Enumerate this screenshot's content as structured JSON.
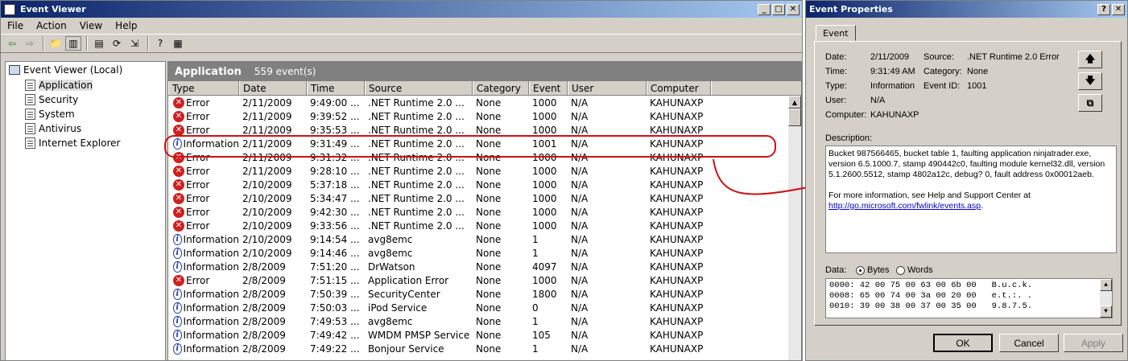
{
  "main_window": {
    "title": "Event Viewer",
    "menu": [
      "File",
      "Action",
      "View",
      "Help"
    ]
  },
  "tree": {
    "root": "Event Viewer (Local)",
    "items": [
      "Application",
      "Security",
      "System",
      "Antivirus",
      "Internet Explorer"
    ]
  },
  "list": {
    "title": "Application",
    "count": "559 event(s)",
    "columns": [
      "Type",
      "Date",
      "Time",
      "Source",
      "Category",
      "Event",
      "User",
      "Computer"
    ],
    "rows": [
      {
        "type": "Error",
        "date": "2/11/2009",
        "time": "9:49:00 ...",
        "source": ".NET Runtime 2.0 ...",
        "category": "None",
        "event": "1000",
        "user": "N/A",
        "computer": "KAHUNAXP"
      },
      {
        "type": "Error",
        "date": "2/11/2009",
        "time": "9:39:52 ...",
        "source": ".NET Runtime 2.0 ...",
        "category": "None",
        "event": "1000",
        "user": "N/A",
        "computer": "KAHUNAXP"
      },
      {
        "type": "Error",
        "date": "2/11/2009",
        "time": "9:35:53 ...",
        "source": ".NET Runtime 2.0 ...",
        "category": "None",
        "event": "1000",
        "user": "N/A",
        "computer": "KAHUNAXP"
      },
      {
        "type": "Information",
        "date": "2/11/2009",
        "time": "9:31:49 ...",
        "source": ".NET Runtime 2.0 ...",
        "category": "None",
        "event": "1001",
        "user": "N/A",
        "computer": "KAHUNAXP"
      },
      {
        "type": "Error",
        "date": "2/11/2009",
        "time": "9:31:32 ...",
        "source": ".NET Runtime 2.0 ...",
        "category": "None",
        "event": "1000",
        "user": "N/A",
        "computer": "KAHUNAXP"
      },
      {
        "type": "Error",
        "date": "2/11/2009",
        "time": "9:28:10 ...",
        "source": ".NET Runtime 2.0 ...",
        "category": "None",
        "event": "1000",
        "user": "N/A",
        "computer": "KAHUNAXP"
      },
      {
        "type": "Error",
        "date": "2/10/2009",
        "time": "5:37:18 ...",
        "source": ".NET Runtime 2.0 ...",
        "category": "None",
        "event": "1000",
        "user": "N/A",
        "computer": "KAHUNAXP"
      },
      {
        "type": "Error",
        "date": "2/10/2009",
        "time": "5:34:47 ...",
        "source": ".NET Runtime 2.0 ...",
        "category": "None",
        "event": "1000",
        "user": "N/A",
        "computer": "KAHUNAXP"
      },
      {
        "type": "Error",
        "date": "2/10/2009",
        "time": "9:42:30 ...",
        "source": ".NET Runtime 2.0 ...",
        "category": "None",
        "event": "1000",
        "user": "N/A",
        "computer": "KAHUNAXP"
      },
      {
        "type": "Error",
        "date": "2/10/2009",
        "time": "9:33:56 ...",
        "source": ".NET Runtime 2.0 ...",
        "category": "None",
        "event": "1000",
        "user": "N/A",
        "computer": "KAHUNAXP"
      },
      {
        "type": "Information",
        "date": "2/10/2009",
        "time": "9:14:54 ...",
        "source": "avg8emc",
        "category": "None",
        "event": "1",
        "user": "N/A",
        "computer": "KAHUNAXP"
      },
      {
        "type": "Information",
        "date": "2/10/2009",
        "time": "9:14:46 ...",
        "source": "avg8emc",
        "category": "None",
        "event": "1",
        "user": "N/A",
        "computer": "KAHUNAXP"
      },
      {
        "type": "Information",
        "date": "2/8/2009",
        "time": "7:51:20 ...",
        "source": "DrWatson",
        "category": "None",
        "event": "4097",
        "user": "N/A",
        "computer": "KAHUNAXP"
      },
      {
        "type": "Error",
        "date": "2/8/2009",
        "time": "7:51:15 ...",
        "source": "Application Error",
        "category": "None",
        "event": "1000",
        "user": "N/A",
        "computer": "KAHUNAXP"
      },
      {
        "type": "Information",
        "date": "2/8/2009",
        "time": "7:50:39 ...",
        "source": "SecurityCenter",
        "category": "None",
        "event": "1800",
        "user": "N/A",
        "computer": "KAHUNAXP"
      },
      {
        "type": "Information",
        "date": "2/8/2009",
        "time": "7:50:03 ...",
        "source": "iPod Service",
        "category": "None",
        "event": "0",
        "user": "N/A",
        "computer": "KAHUNAXP"
      },
      {
        "type": "Information",
        "date": "2/8/2009",
        "time": "7:49:53 ...",
        "source": "avg8emc",
        "category": "None",
        "event": "1",
        "user": "N/A",
        "computer": "KAHUNAXP"
      },
      {
        "type": "Information",
        "date": "2/8/2009",
        "time": "7:49:42 ...",
        "source": "WMDM PMSP Service",
        "category": "None",
        "event": "105",
        "user": "N/A",
        "computer": "KAHUNAXP"
      },
      {
        "type": "Information",
        "date": "2/8/2009",
        "time": "7:49:22 ...",
        "source": "Bonjour Service",
        "category": "None",
        "event": "1",
        "user": "N/A",
        "computer": "KAHUNAXP"
      }
    ]
  },
  "props": {
    "title": "Event Properties",
    "tab": "Event",
    "date_label": "Date:",
    "date": "2/11/2009",
    "source_label": "Source:",
    "source": ".NET Runtime 2.0 Error",
    "time_label": "Time:",
    "time": "9:31:49 AM",
    "category_label": "Category:",
    "category": "None",
    "type_label": "Type:",
    "type": "Information",
    "eventid_label": "Event ID:",
    "eventid": "1001",
    "user_label": "User:",
    "user": "N/A",
    "computer_label": "Computer:",
    "computer": "KAHUNAXP",
    "description_label": "Description:",
    "description": "Bucket 987566465, bucket table 1, faulting application ninjatrader.exe, version 6.5.1000.7, stamp 490442c0, faulting module kernel32.dll, version 5.1.2600.5512, stamp 4802a12c, debug? 0, fault address 0x00012aeb.",
    "more_info": "For more information, see Help and Support Center at",
    "link": "http://go.microsoft.com/fwlink/events.asp",
    "link_suffix": ".",
    "data_label": "Data:",
    "bytes_label": "Bytes",
    "words_label": "Words",
    "data_lines": [
      "0000: 42 00 75 00 63 00 6b 00   B.u.c.k.",
      "0008: 65 00 74 00 3a 00 20 00   e.t.:. .",
      "0010: 39 00 38 00 37 00 35 00   9.8.7.5."
    ],
    "ok": "OK",
    "cancel": "Cancel",
    "apply": "Apply"
  }
}
